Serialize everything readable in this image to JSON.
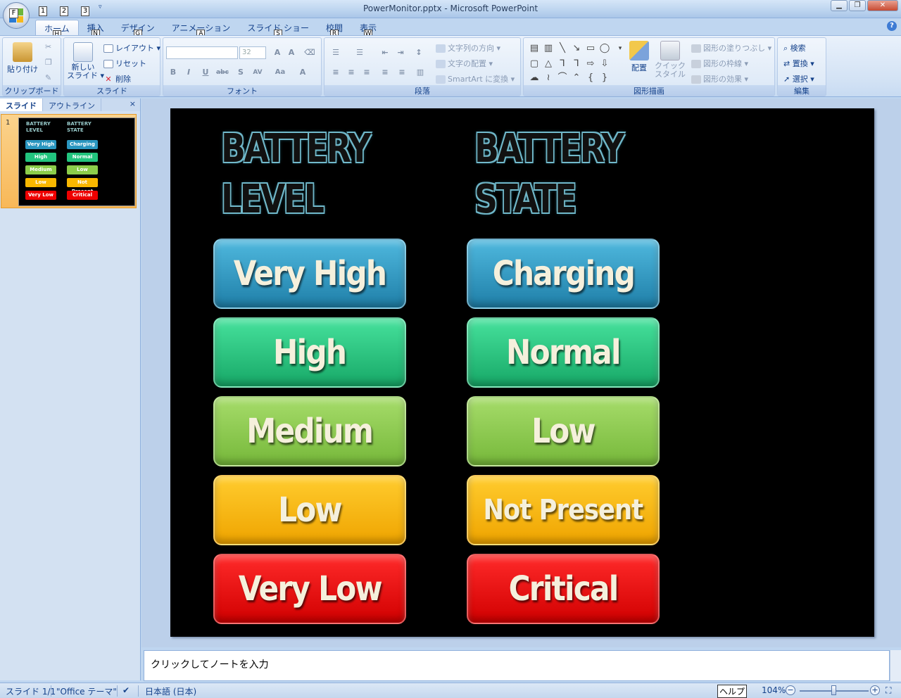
{
  "window": {
    "title": "PowerMonitor.pptx - Microsoft PowerPoint",
    "office_key": "F",
    "qat_keys": [
      "1",
      "2",
      "3"
    ]
  },
  "tabs": [
    {
      "label": "ホーム",
      "key": "H"
    },
    {
      "label": "挿入",
      "key": "N"
    },
    {
      "label": "デザイン",
      "key": "G"
    },
    {
      "label": "アニメーション",
      "key": "A"
    },
    {
      "label": "スライド ショー",
      "key": "S"
    },
    {
      "label": "校閲",
      "key": "R"
    },
    {
      "label": "表示",
      "key": "W"
    }
  ],
  "ribbon": {
    "clipboard": {
      "label": "クリップボード",
      "paste": "貼り付け"
    },
    "slides": {
      "label": "スライド",
      "new_slide_1": "新しい",
      "new_slide_2": "スライド",
      "layout": "レイアウト",
      "reset": "リセット",
      "delete": "削除"
    },
    "font": {
      "label": "フォント",
      "size": "32"
    },
    "paragraph": {
      "label": "段落",
      "text_direction": "文字列の方向",
      "align_text": "文字の配置",
      "smartart": "SmartArt に変換"
    },
    "drawing": {
      "label": "図形描画",
      "arrange": "配置",
      "quick_styles_1": "クイック",
      "quick_styles_2": "スタイル",
      "fill": "図形の塗りつぶし",
      "outline": "図形の枠線",
      "effects": "図形の効果"
    },
    "editing": {
      "label": "編集",
      "find": "検索",
      "replace": "置換",
      "select": "選択"
    }
  },
  "left_panel": {
    "tab_slides": "スライド",
    "tab_outline": "アウトライン",
    "close": "×",
    "thumb_number": "1"
  },
  "slide": {
    "heading_left": [
      "BATTERY",
      "LEVEL"
    ],
    "heading_right": [
      "BATTERY",
      "STATE"
    ],
    "level_buttons": [
      "Very High",
      "High",
      "Medium",
      "Low",
      "Very Low"
    ],
    "state_buttons": [
      "Charging",
      "Normal",
      "Low",
      "Not Present",
      "Critical"
    ],
    "button_colors": [
      "#2a96c0",
      "#22c47e",
      "#8ccd4a",
      "#f9b800",
      "#ee0000"
    ]
  },
  "notes": {
    "placeholder": "クリックしてノートを入力"
  },
  "status": {
    "slide": "スライド 1/1",
    "theme": "\"Office テーマ\"",
    "language": "日本語 (日本)",
    "help_tooltip": "ヘルプ",
    "zoom": "104%"
  }
}
